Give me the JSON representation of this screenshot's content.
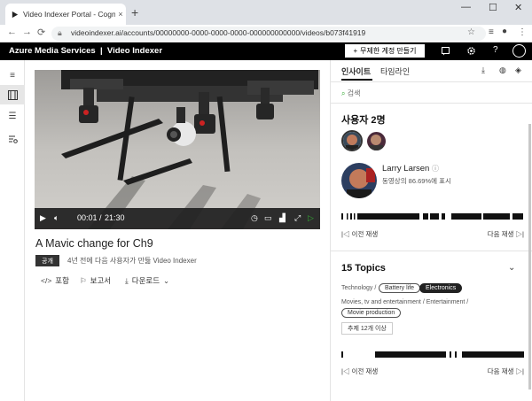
{
  "browser": {
    "tab_title": "Video Indexer Portal - Cognitive",
    "tab_close": "×",
    "new_tab": "+",
    "window_controls": [
      "—",
      "☐",
      "✕"
    ],
    "url": "videoindexer.ai/accounts/00000000-0000-0000-0000-000000000000/videos/b073f41919"
  },
  "appbar": {
    "brand": "Azure Media Services  |  Video Indexer",
    "create_account": "무제한 계정 만들기"
  },
  "player": {
    "time_current": "00:01",
    "time_separator": "/",
    "time_total": "21:30"
  },
  "video": {
    "title": "A Mavic change for Ch9",
    "visibility_badge": "공개",
    "meta": "4년 전에 다음 사용자가 만듦 Video Indexer",
    "actions": [
      "포함",
      "보고서",
      "다운로드"
    ]
  },
  "panel": {
    "tabs": [
      "인사이트",
      "타임라인"
    ],
    "search_placeholder": "검색",
    "people_title": "사용자 2명",
    "person_name": "Larry Larsen",
    "person_info": "동영상의 86.69%에 표시",
    "prev_label": "이전 재생",
    "next_label": "다음 재생",
    "topics_title": "15 Topics",
    "topic_category_1": "Technology /",
    "topic_chips_1": [
      "Battery life",
      "Electronics"
    ],
    "topic_category_2": "Movies, tv and entertainment / Entertainment /",
    "topic_chips_2": [
      "Movie production"
    ],
    "more_button": "추제 12개 이상",
    "prev_label_2": "이전 재생",
    "next_label_2": "다음 재생"
  },
  "colors": {
    "appbar_bg": "#000000",
    "accent": "#000000"
  }
}
